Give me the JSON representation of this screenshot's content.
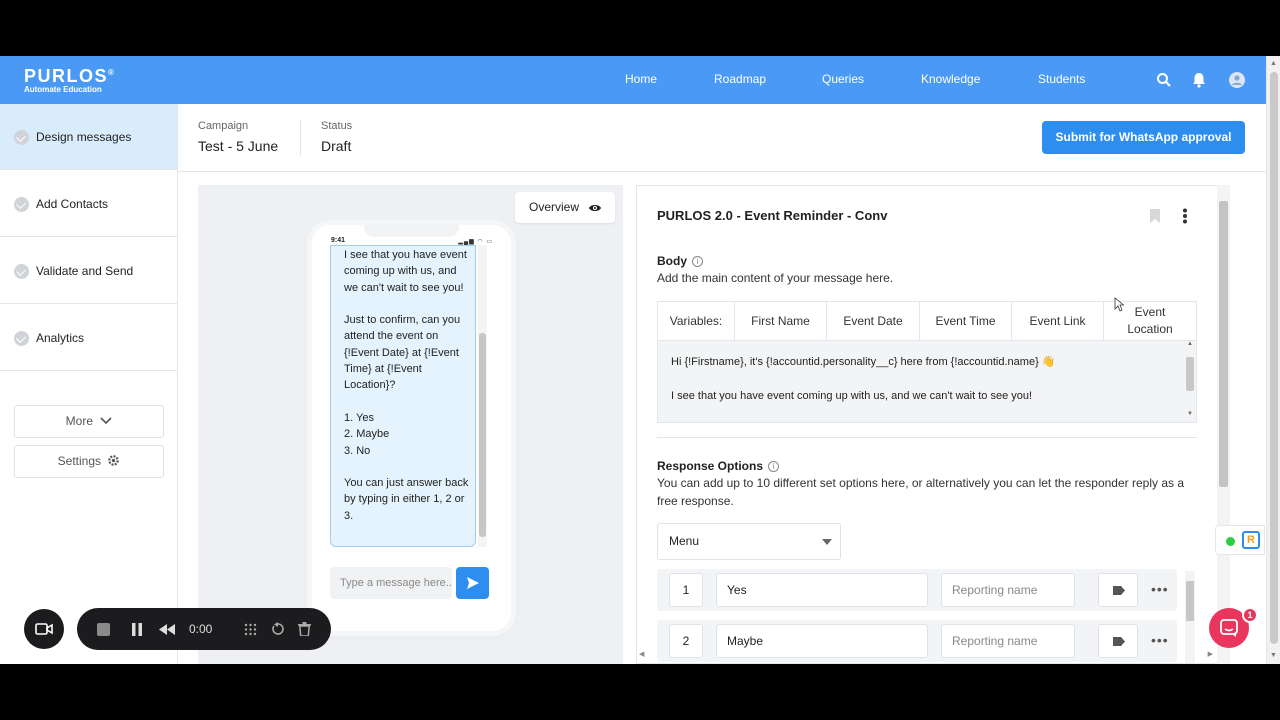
{
  "brand": {
    "name": "PURLOS",
    "tagline": "Automate Education",
    "accent": "#4a9af5",
    "primary_button": "#2e8ef0"
  },
  "nav": {
    "links": [
      "Home",
      "Roadmap",
      "Queries",
      "Knowledge",
      "Students"
    ],
    "icons": [
      "search-icon",
      "bell-icon",
      "user-icon"
    ]
  },
  "sidebar": {
    "items": [
      {
        "label": "Design messages",
        "active": true
      },
      {
        "label": "Add Contacts",
        "active": false
      },
      {
        "label": "Validate and Send",
        "active": false
      },
      {
        "label": "Analytics",
        "active": false
      }
    ],
    "more_label": "More",
    "settings_label": "Settings"
  },
  "campaign": {
    "campaign_label": "Campaign",
    "campaign_value": "Test - 5 June",
    "status_label": "Status",
    "status_value": "Draft",
    "submit_label": "Submit for WhatsApp approval"
  },
  "preview": {
    "overview_label": "Overview",
    "phone_time": "9:41",
    "message": "I see that you have event coming up with us, and we can't wait to see you!\n\nJust to confirm, can you attend the event on {!Event Date} at {!Event Time} at {!Event Location}?\n\n1. Yes\n2. Maybe\n3. No\n\nYou can just answer back by typing in either 1, 2 or 3.",
    "input_placeholder": "Type a message here..."
  },
  "editor": {
    "template_title": "PURLOS 2.0 - Event Reminder - Conv",
    "body_title": "Body",
    "body_desc": "Add the main content of your message here.",
    "variables_label": "Variables:",
    "variables": [
      "First Name",
      "Event Date",
      "Event Time",
      "Event Link",
      "Event Location"
    ],
    "body_text": "Hi {!Firstname}, it's {!accountid.personality__c} here from {!accountid.name} 👋\n\nI see that you have event coming up with us, and we can't wait to see you!",
    "response_title": "Response Options",
    "response_desc": "You can add up to 10 different set options here, or alternatively you can let the responder reply as a free response.",
    "response_type": "Menu",
    "options": [
      {
        "num": "1",
        "label": "Yes",
        "reporting_placeholder": "Reporting name"
      },
      {
        "num": "2",
        "label": "Maybe",
        "reporting_placeholder": "Reporting name"
      }
    ]
  },
  "recorder": {
    "time": "0:00"
  },
  "chat": {
    "badge": "1"
  }
}
